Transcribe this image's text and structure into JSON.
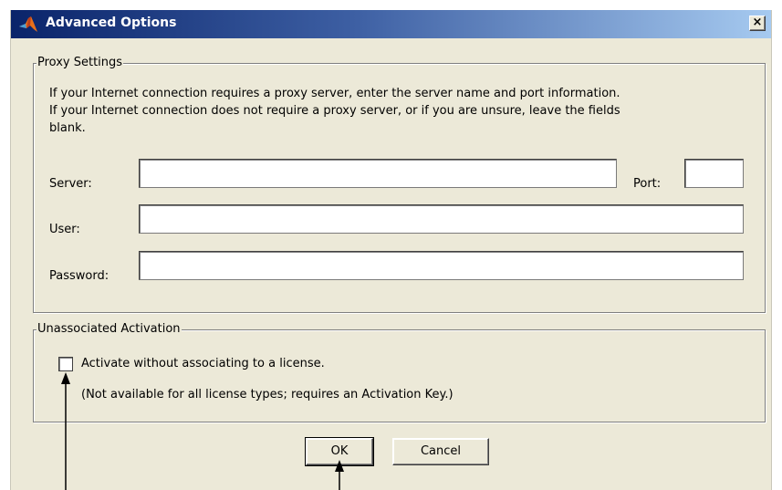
{
  "window": {
    "title": "Advanced Options",
    "close_glyph": "×",
    "icon": "matlab-logo-icon"
  },
  "proxy": {
    "legend": "Proxy Settings",
    "description_line1": "If your Internet connection requires a proxy server, enter the server name and port information.",
    "description_line2": "If your Internet connection does not require a proxy server, or if you are unsure, leave the fields",
    "description_line3": "blank.",
    "server_label": "Server:",
    "server_value": "",
    "port_label": "Port:",
    "port_value": "",
    "user_label": "User:",
    "user_value": "",
    "password_label": "Password:",
    "password_value": ""
  },
  "activation": {
    "legend": "Unassociated Activation",
    "checkbox_label": "Activate without associating to a license.",
    "checkbox_checked": false,
    "note": "(Not available for all license types; requires an Activation Key.)"
  },
  "buttons": {
    "ok_label": "OK",
    "cancel_label": "Cancel"
  },
  "colors": {
    "dialog_bg": "#ece9d8",
    "titlebar_start": "#0a246a",
    "titlebar_end": "#a6caf0"
  }
}
